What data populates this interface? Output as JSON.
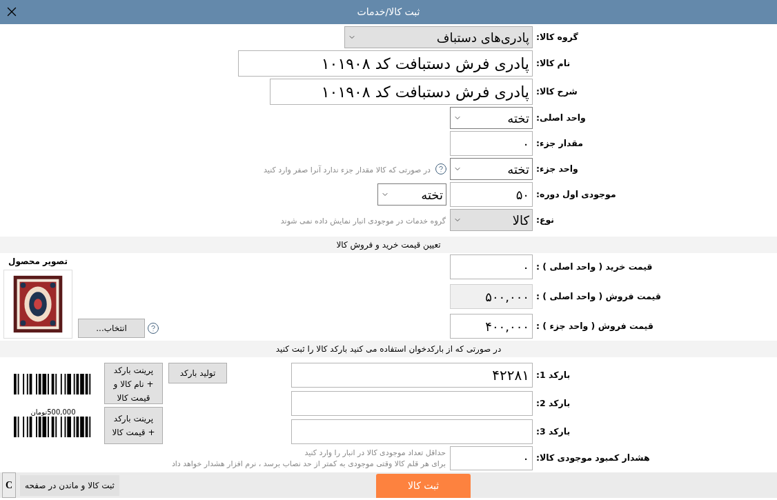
{
  "window": {
    "title": "ثبت کالا/خدمات"
  },
  "fields": [
    {
      "label": "گروه کالا:",
      "kind": "select",
      "value": "پادری‌های دستباف",
      "disabled": true
    },
    {
      "label": "نام کالا:",
      "kind": "input",
      "value": "پادری فرش دستبافت کد ۱۰۱۹۰۸",
      "disabled": false
    },
    {
      "label": "شرح کالا:",
      "kind": "input",
      "value": "پادری فرش دستبافت کد ۱۰۱۹۰۸",
      "disabled": false
    },
    {
      "label": "واحد اصلی:",
      "kind": "select",
      "value": "تخته",
      "disabled": false
    },
    {
      "label": "مقدار جزء:",
      "kind": "input",
      "value": "۰",
      "disabled": false
    },
    {
      "label": "واحد جزء:",
      "kind": "select",
      "value": "تخته",
      "disabled": false,
      "help": true,
      "hint": "در صورتی که کالا مقدار جزء ندارد آنرا صفر وارد کنید"
    },
    {
      "label": "موجودی اول دوره:",
      "kind": "input",
      "value": "۵۰",
      "disabled": false,
      "unit": "تخته"
    },
    {
      "label": "نوع:",
      "kind": "select",
      "value": "کالا",
      "disabled": true,
      "hint": "گروه خدمات در موجودی انبار نمایش داده نمی شوند"
    }
  ],
  "price_section": {
    "title": "تعیین قیمت خرید و فروش کالا",
    "image_label": "تصویر محصول",
    "choose_button": "انتخاب...",
    "rows": [
      {
        "label": "قیمت خرید ( واحد اصلی ) :",
        "value": "۰",
        "disabled": false
      },
      {
        "label": "قیمت فروش ( واحد اصلی ) :",
        "value": "۵۰۰,۰۰۰",
        "disabled": true
      },
      {
        "label": "قیمت فروش ( واحد جزء ) :",
        "value": "۴۰۰,۰۰۰",
        "disabled": false
      }
    ]
  },
  "barcode_section": {
    "title": "در صورتی که از بارکدخوان استفاده می کنید بارکد کالا را ثبت کنید",
    "rows": [
      {
        "label": "بارکد 1:",
        "value": "۴۲۲۸۱"
      },
      {
        "label": "بارکد 2:"
      },
      {
        "label": "بارکد 3:"
      }
    ],
    "generate_button": "تولید بارکد",
    "print_buttons": [
      "پرینت بارکد + نام کالا و قیمت کالا",
      "پرینت بارکد + قیمت کالا"
    ],
    "preview_price": "500,000تومان",
    "warning": {
      "label": "هشدار کمبود موجودی کالا:",
      "value": "۰",
      "hint_lines": [
        "حداقل تعداد موجودی کالا در انبار را وارد کنید",
        "برای هر قلم کالا وقتی موجودی به کمتر از حد نصاب برسد ، نرم افزار هشدار خواهد داد"
      ]
    }
  },
  "footer": {
    "save_button": "ثبت کالا",
    "save_stay_button": "ثبت کالا و ماندن در صفحه",
    "c_button": "C"
  }
}
